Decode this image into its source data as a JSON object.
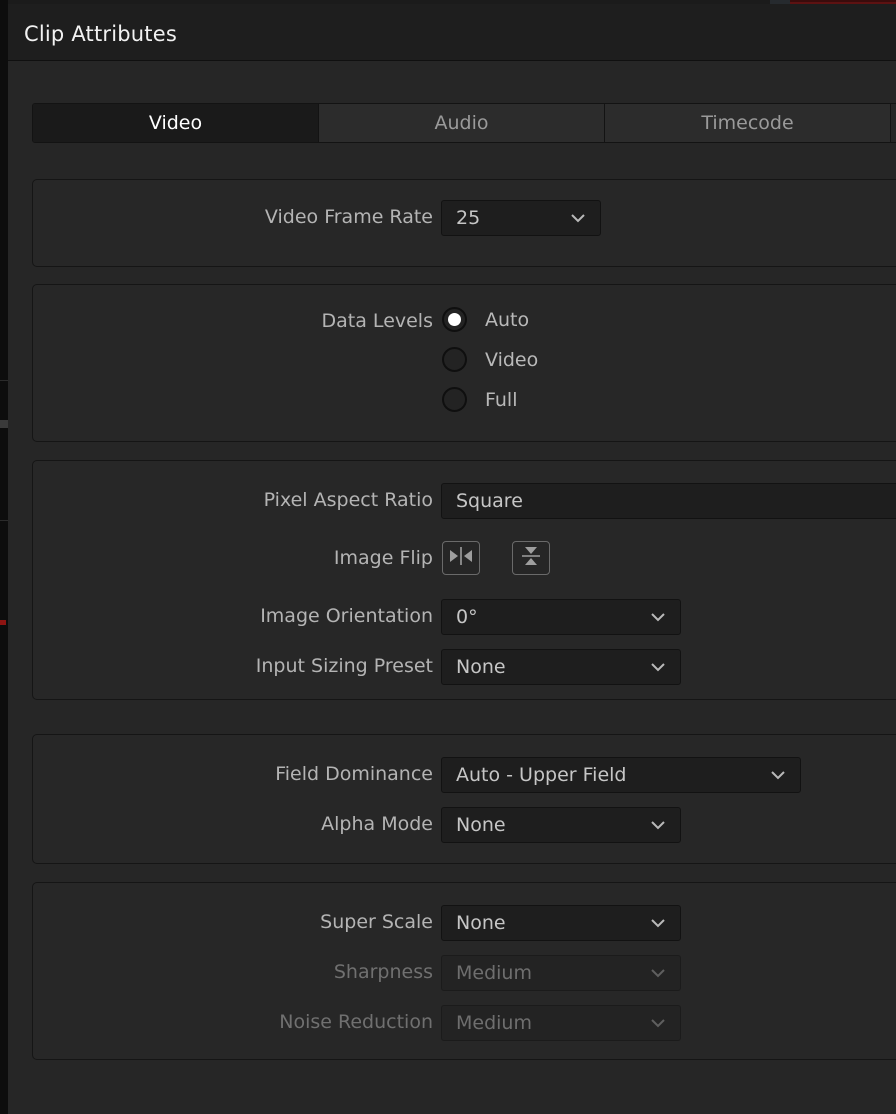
{
  "window": {
    "title": "Clip Attributes"
  },
  "tabs": [
    {
      "label": "Video",
      "active": true
    },
    {
      "label": "Audio",
      "active": false
    },
    {
      "label": "Timecode",
      "active": false
    }
  ],
  "groups": {
    "frame_rate": {
      "label": "Video Frame Rate",
      "value": "25"
    },
    "data_levels": {
      "label": "Data Levels",
      "options": [
        {
          "label": "Auto",
          "selected": true
        },
        {
          "label": "Video",
          "selected": false
        },
        {
          "label": "Full",
          "selected": false
        }
      ]
    },
    "image": {
      "pixel_aspect_ratio": {
        "label": "Pixel Aspect Ratio",
        "value": "Square"
      },
      "image_flip": {
        "label": "Image Flip",
        "horizontal_icon": "flip-horizontal-icon",
        "vertical_icon": "flip-vertical-icon"
      },
      "image_orientation": {
        "label": "Image Orientation",
        "value": "0°"
      },
      "input_sizing_preset": {
        "label": "Input Sizing Preset",
        "value": "None"
      }
    },
    "field": {
      "field_dominance": {
        "label": "Field Dominance",
        "value": "Auto - Upper Field"
      },
      "alpha_mode": {
        "label": "Alpha Mode",
        "value": "None"
      }
    },
    "scale": {
      "super_scale": {
        "label": "Super Scale",
        "value": "None",
        "disabled": false
      },
      "sharpness": {
        "label": "Sharpness",
        "value": "Medium",
        "disabled": true
      },
      "noise_reduction": {
        "label": "Noise Reduction",
        "value": "Medium",
        "disabled": true
      }
    }
  },
  "colors": {
    "panel_background": "#262626",
    "titlebar_background": "#1e1e1e",
    "active_tab_background": "#1a1a1a",
    "field_background": "#1e1e1e",
    "label_text": "#b4b4b4",
    "disabled_text": "#6e6e6e",
    "title_text": "#f2f2f2"
  }
}
